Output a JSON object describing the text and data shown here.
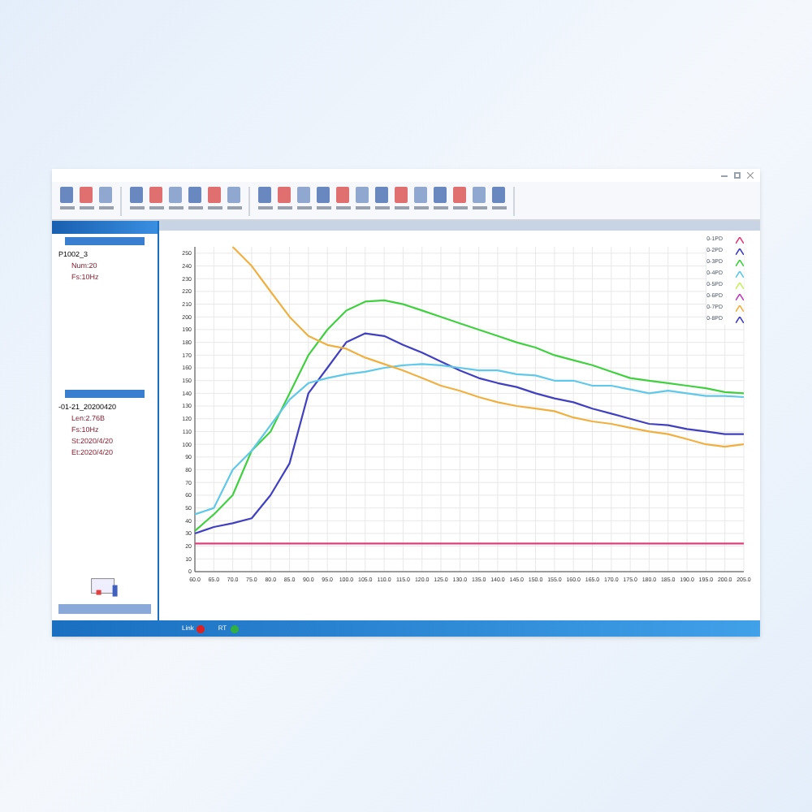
{
  "tree_top": {
    "root": "P1002_3",
    "children": [
      "Num:20",
      "Fs:10Hz"
    ]
  },
  "tree_bottom": {
    "root": "-01-21_20200420",
    "children": [
      "Len:2.76B",
      "Fs:10Hz",
      "St:2020/4/20",
      "Et:2020/4/20"
    ]
  },
  "legend": [
    {
      "label": "0-1PD",
      "color": "#e0407a"
    },
    {
      "label": "0-2PD",
      "color": "#4040c0"
    },
    {
      "label": "0-3PD",
      "color": "#40d040"
    },
    {
      "label": "0-4PD",
      "color": "#60c8e8"
    },
    {
      "label": "0-5PD",
      "color": "#c8f060"
    },
    {
      "label": "0-6PD",
      "color": "#c040c0"
    },
    {
      "label": "0-7PD",
      "color": "#f0b040"
    },
    {
      "label": "0-8PD",
      "color": "#4040c0"
    }
  ],
  "chart_data": {
    "type": "line",
    "grid": true,
    "xlim": [
      60,
      205
    ],
    "ylim": [
      0,
      255
    ],
    "x": [
      60,
      65,
      70,
      75,
      80,
      85,
      90,
      95,
      100,
      105,
      110,
      115,
      120,
      125,
      130,
      135,
      140,
      145,
      150,
      155,
      160,
      165,
      170,
      175,
      180,
      185,
      190,
      195,
      200,
      205
    ],
    "xticks": [
      {
        "value": 60,
        "label": "60.0"
      },
      {
        "value": 65,
        "label": "65.0"
      },
      {
        "value": 70,
        "label": "70.0"
      },
      {
        "value": 75,
        "label": "75.0"
      },
      {
        "value": 80,
        "label": "80.0"
      },
      {
        "value": 85,
        "label": "85.0"
      },
      {
        "value": 90,
        "label": "90.0"
      },
      {
        "value": 95,
        "label": "95.0"
      },
      {
        "value": 100,
        "label": "100.0"
      },
      {
        "value": 105,
        "label": "105.0"
      },
      {
        "value": 110,
        "label": "110.0"
      },
      {
        "value": 115,
        "label": "115.0"
      },
      {
        "value": 120,
        "label": "120.0"
      },
      {
        "value": 125,
        "label": "125.0"
      },
      {
        "value": 130,
        "label": "130.0"
      },
      {
        "value": 135,
        "label": "135.0"
      },
      {
        "value": 140,
        "label": "140.0"
      },
      {
        "value": 145,
        "label": "145.0"
      },
      {
        "value": 150,
        "label": "150.0"
      },
      {
        "value": 155,
        "label": "155.0"
      },
      {
        "value": 160,
        "label": "160.0"
      },
      {
        "value": 165,
        "label": "165.0"
      },
      {
        "value": 170,
        "label": "170.0"
      },
      {
        "value": 175,
        "label": "175.0"
      },
      {
        "value": 180,
        "label": "180.0"
      },
      {
        "value": 185,
        "label": "185.0"
      },
      {
        "value": 190,
        "label": "190.0"
      },
      {
        "value": 195,
        "label": "195.0"
      },
      {
        "value": 200,
        "label": "200.0"
      },
      {
        "value": 205,
        "label": "205.0"
      }
    ],
    "yticks": [
      0,
      10,
      20,
      30,
      40,
      50,
      60,
      70,
      80,
      90,
      100,
      110,
      120,
      130,
      140,
      150,
      160,
      170,
      180,
      190,
      200,
      210,
      220,
      230,
      240,
      250
    ],
    "series": [
      {
        "color": "#e0407a",
        "values": [
          22,
          22,
          22,
          22,
          22,
          22,
          22,
          22,
          22,
          22,
          22,
          22,
          22,
          22,
          22,
          22,
          22,
          22,
          22,
          22,
          22,
          22,
          22,
          22,
          22,
          22,
          22,
          22,
          22,
          22
        ]
      },
      {
        "color": "#4040c0",
        "values": [
          30,
          35,
          38,
          42,
          60,
          85,
          140,
          160,
          180,
          187,
          185,
          178,
          172,
          165,
          158,
          152,
          148,
          145,
          140,
          136,
          133,
          128,
          124,
          120,
          116,
          115,
          112,
          110,
          108,
          108
        ]
      },
      {
        "color": "#40d040",
        "values": [
          32,
          45,
          60,
          95,
          110,
          140,
          170,
          190,
          205,
          212,
          213,
          210,
          205,
          200,
          195,
          190,
          185,
          180,
          176,
          170,
          166,
          162,
          157,
          152,
          150,
          148,
          146,
          144,
          141,
          140
        ]
      },
      {
        "color": "#60c8e8",
        "values": [
          45,
          50,
          80,
          95,
          115,
          135,
          148,
          152,
          155,
          157,
          160,
          162,
          163,
          162,
          160,
          158,
          158,
          155,
          154,
          150,
          150,
          146,
          146,
          143,
          140,
          142,
          140,
          138,
          138,
          137
        ]
      },
      {
        "color": "#f0b040",
        "values": [
          null,
          null,
          255,
          240,
          220,
          200,
          185,
          178,
          175,
          168,
          163,
          158,
          152,
          146,
          142,
          137,
          133,
          130,
          128,
          126,
          121,
          118,
          116,
          113,
          110,
          108,
          104,
          100,
          98,
          100
        ]
      }
    ]
  },
  "status": {
    "items": [
      {
        "label": "Link",
        "on": false
      },
      {
        "label": "RT",
        "on": true
      }
    ]
  }
}
